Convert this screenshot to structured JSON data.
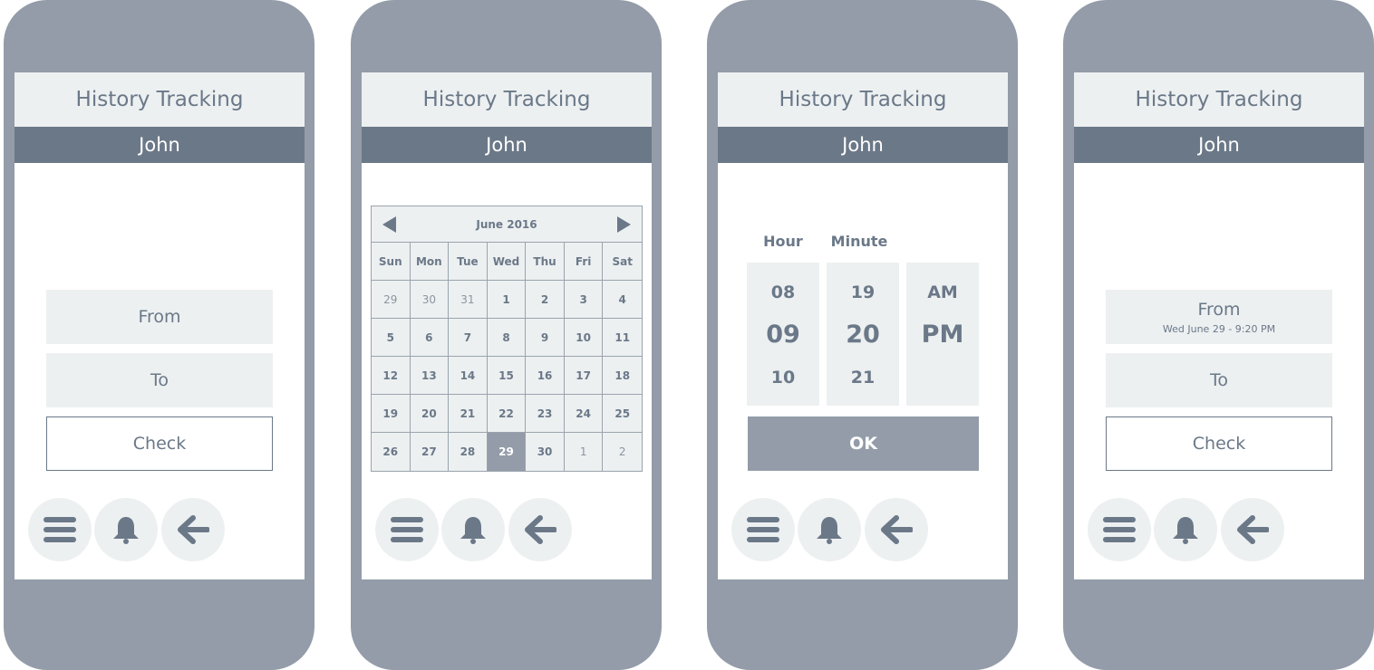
{
  "colors": {
    "device": "#939ca8",
    "accent_dark": "#6b7888",
    "panel": "#edf0f1",
    "text": "#6a7888"
  },
  "screens": [
    {
      "app_title": "History Tracking",
      "user": "John",
      "from_label": "From",
      "to_label": "To",
      "check_label": "Check"
    },
    {
      "app_title": "History Tracking",
      "user": "John",
      "calendar": {
        "month_label": "June 2016",
        "weekdays": [
          "Sun",
          "Mon",
          "Tue",
          "Wed",
          "Thu",
          "Fri",
          "Sat"
        ],
        "days": [
          "29",
          "30",
          "31",
          "1",
          "2",
          "3",
          "4",
          "5",
          "6",
          "7",
          "8",
          "9",
          "10",
          "11",
          "12",
          "13",
          "14",
          "15",
          "16",
          "17",
          "18",
          "19",
          "20",
          "21",
          "22",
          "23",
          "24",
          "25",
          "26",
          "27",
          "28",
          "29",
          "30",
          "1",
          "2"
        ],
        "dim_indices": [
          0,
          1,
          2,
          33,
          34
        ],
        "selected_index": 31
      }
    },
    {
      "app_title": "History Tracking",
      "user": "John",
      "time_picker": {
        "hour_label": "Hour",
        "minute_label": "Minute",
        "hours": [
          "08",
          "09",
          "10"
        ],
        "minutes": [
          "19",
          "20",
          "21"
        ],
        "periods": [
          "AM",
          "PM"
        ],
        "ok_label": "OK"
      }
    },
    {
      "app_title": "History Tracking",
      "user": "John",
      "from_label": "From",
      "from_value": "Wed June 29 - 9:20 PM",
      "to_label": "To",
      "check_label": "Check"
    }
  ],
  "bottom_nav_icons": [
    "menu-icon",
    "bell-icon",
    "back-arrow-icon"
  ]
}
